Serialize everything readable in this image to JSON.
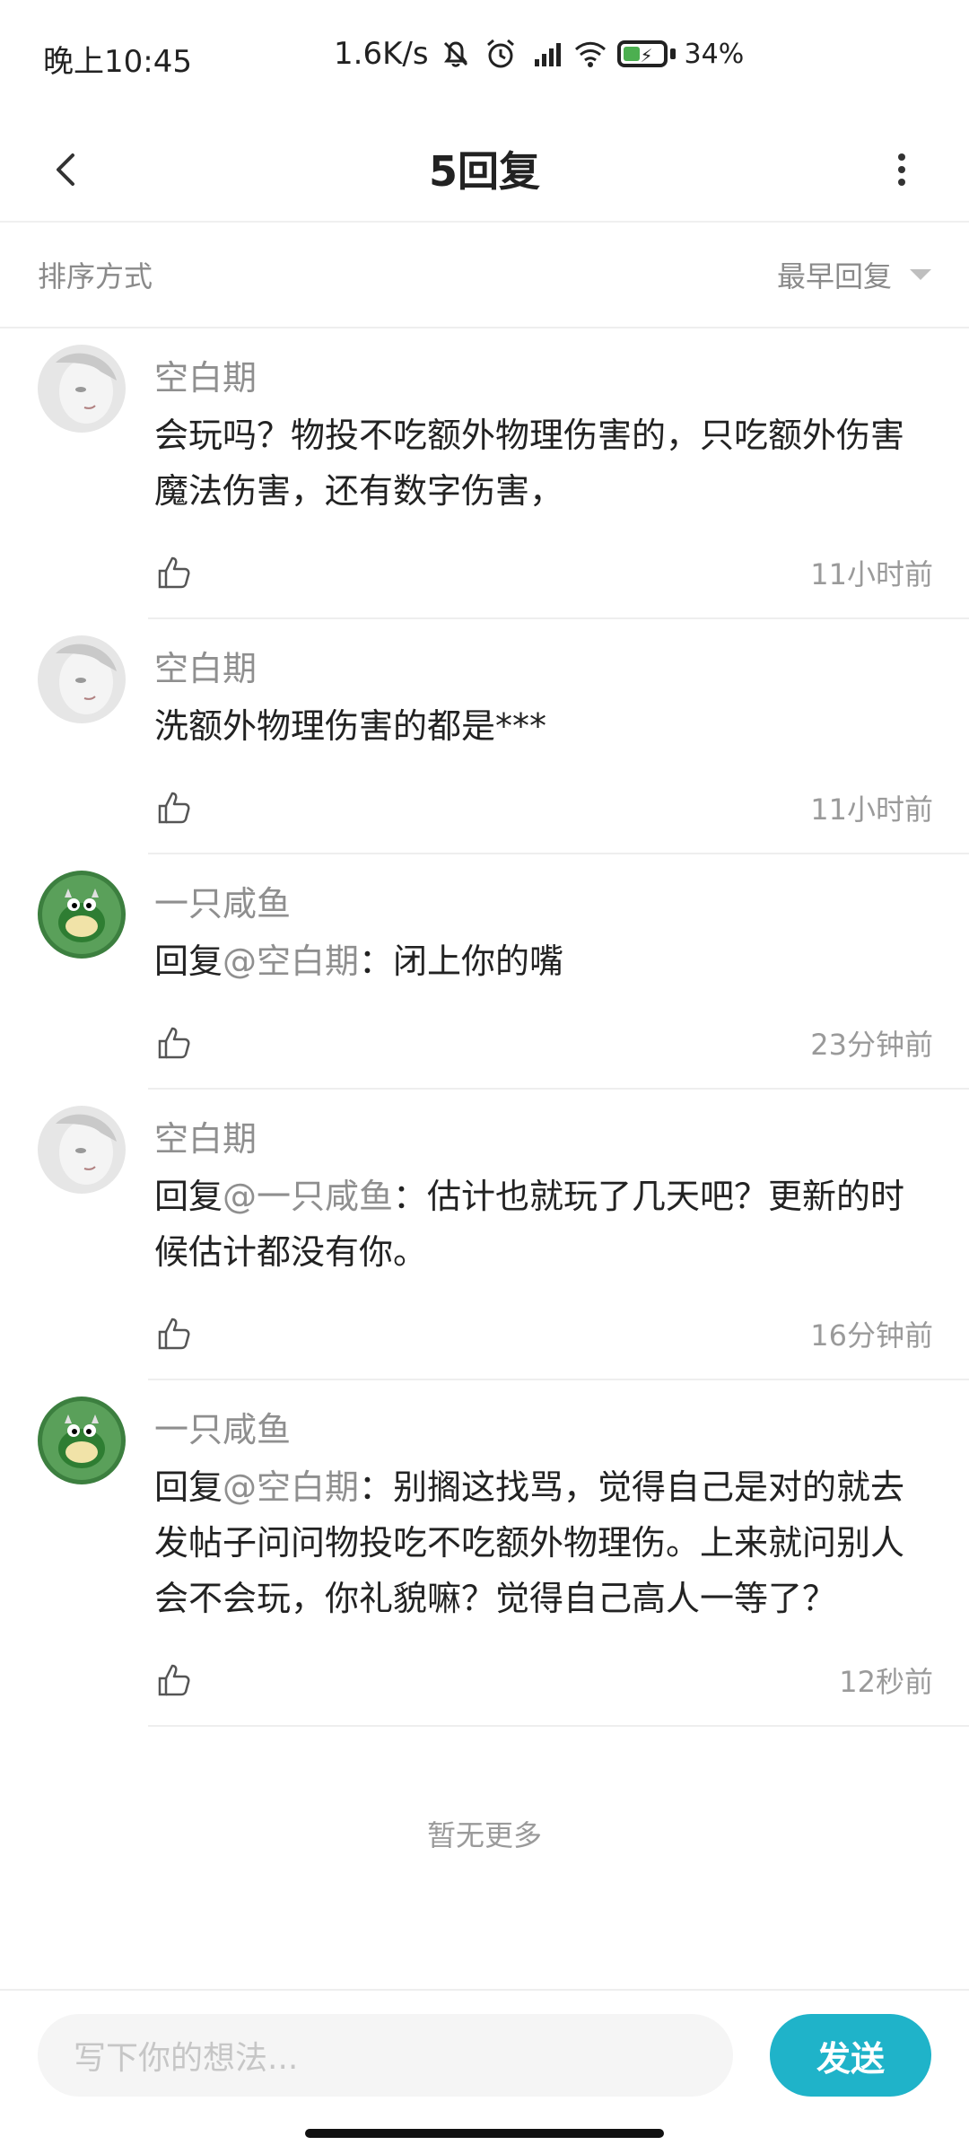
{
  "status": {
    "time": "晚上10:45",
    "speed": "1.6K/s",
    "battery": "34%"
  },
  "header": {
    "title": "5回复"
  },
  "sort": {
    "label": "排序方式",
    "selected": "最早回复"
  },
  "replies": [
    {
      "user": "空白期",
      "prefix": "",
      "mention": "",
      "text": "会玩吗？物投不吃额外物理伤害的，只吃额外伤害魔法伤害，还有数字伤害，",
      "time": "11小时前"
    },
    {
      "user": "空白期",
      "prefix": "",
      "mention": "",
      "text": "洗额外物理伤害的都是***",
      "time": "11小时前"
    },
    {
      "user": "一只咸鱼",
      "prefix": "回复",
      "mention": "@空白期",
      "text": "：闭上你的嘴",
      "time": "23分钟前"
    },
    {
      "user": "空白期",
      "prefix": "回复",
      "mention": "@一只咸鱼",
      "text": "：估计也就玩了几天吧？更新的时候估计都没有你。",
      "time": "16分钟前"
    },
    {
      "user": "一只咸鱼",
      "prefix": "回复",
      "mention": "@空白期",
      "text": "：别搁这找骂，觉得自己是对的就去发帖子问问物投吃不吃额外物理伤。上来就问别人会不会玩，你礼貌嘛？觉得自己高人一等了？",
      "time": "12秒前"
    }
  ],
  "footer": {
    "no_more": "暂无更多",
    "input_placeholder": "写下你的想法...",
    "send_label": "发送"
  }
}
